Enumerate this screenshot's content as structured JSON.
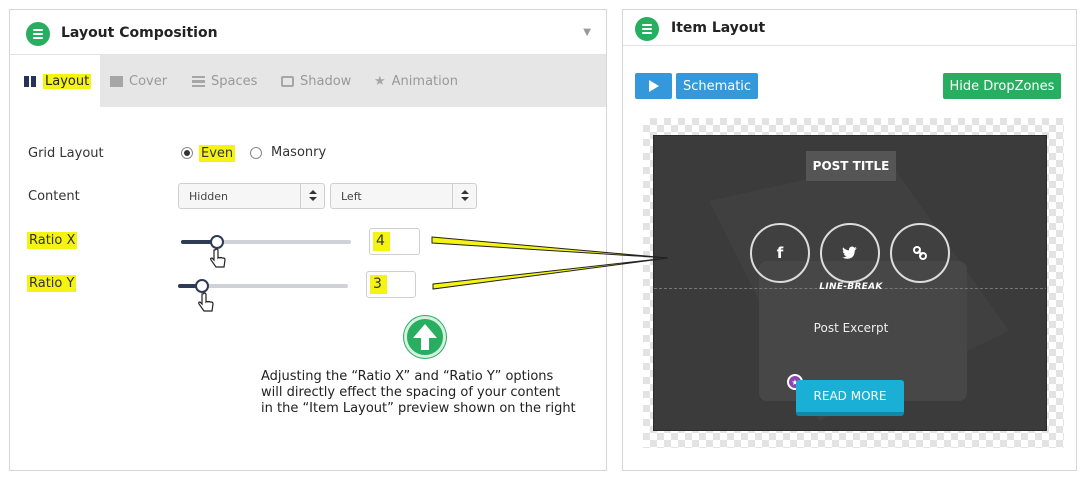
{
  "left_panel": {
    "title": "Layout Composition",
    "caret": "▼",
    "tabs": [
      {
        "label": "Layout",
        "active": true,
        "icon": "layout-icon"
      },
      {
        "label": "Cover",
        "active": false,
        "icon": "cover-icon"
      },
      {
        "label": "Spaces",
        "active": false,
        "icon": "spaces-icon"
      },
      {
        "label": "Shadow",
        "active": false,
        "icon": "shadow-icon"
      },
      {
        "label": "Animation",
        "active": false,
        "icon": "star-icon"
      }
    ],
    "grid_layout": {
      "label": "Grid Layout",
      "options": [
        {
          "label": "Even",
          "selected": true
        },
        {
          "label": "Masonry",
          "selected": false
        }
      ]
    },
    "content": {
      "label": "Content",
      "select1": "Hidden",
      "select2": "Left"
    },
    "ratio_x": {
      "label": "Ratio X",
      "value": "4"
    },
    "ratio_y": {
      "label": "Ratio Y",
      "value": "3"
    },
    "note": "Adjusting the “Ratio X” and “Ratio Y” options\nwill directly effect the spacing of your content\nin the “Item Layout” preview shown on the right"
  },
  "right_panel": {
    "title": "Item Layout",
    "schematic_label": "Schematic",
    "hide_dropzones_label": "Hide DropZones",
    "preview": {
      "post_title": "POST TITLE",
      "share_icons": [
        "f",
        "twitter-icon",
        "link-icon"
      ],
      "line_break": "LINE-BREAK",
      "excerpt": "Post Excerpt",
      "read_more": "READ MORE"
    }
  },
  "colors": {
    "highlight": "#f5f312",
    "green": "#27ae60",
    "blue": "#3498db",
    "card": "#3b3b3b",
    "read_more": "#1ab0d6"
  }
}
